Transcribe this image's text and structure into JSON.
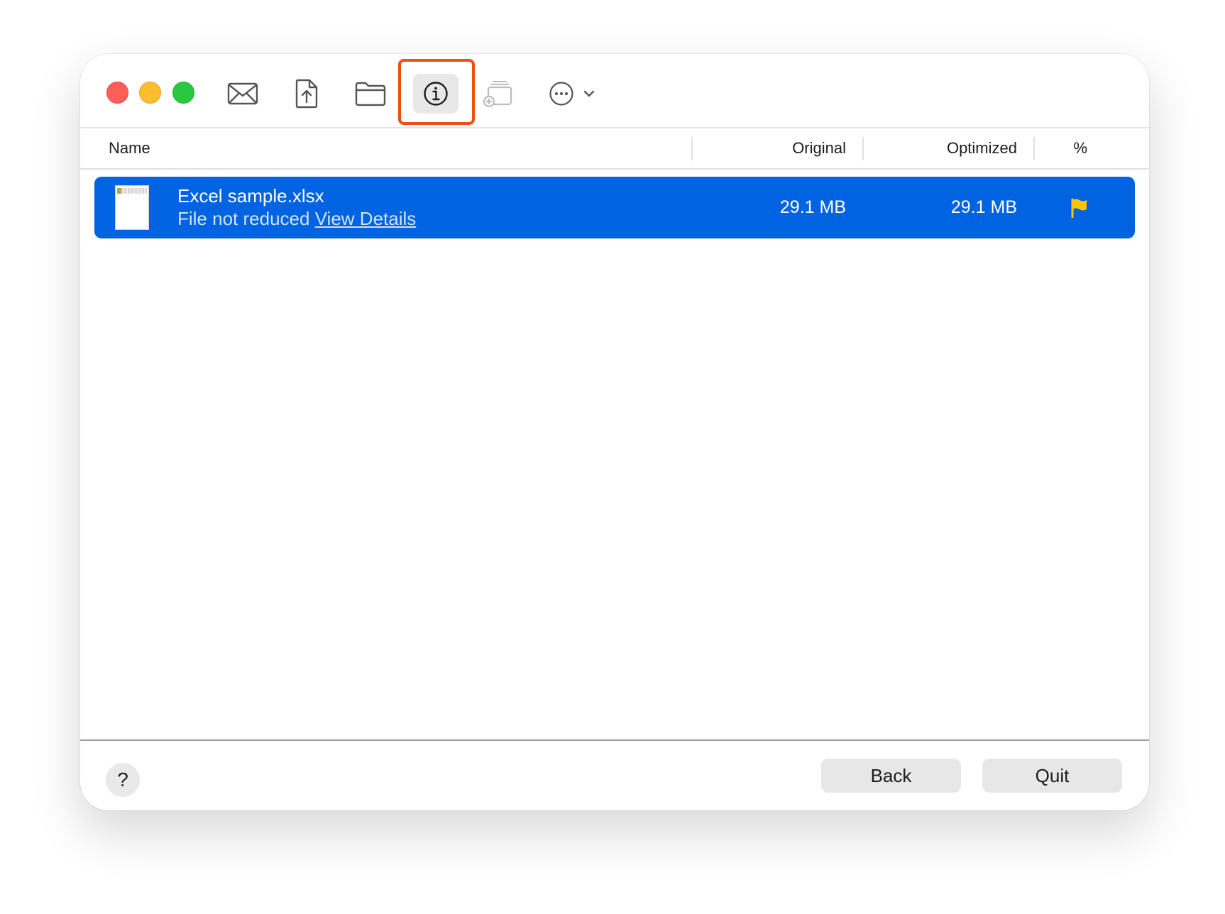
{
  "toolbar": {
    "icons": [
      "envelope-icon",
      "share-file-icon",
      "folder-icon",
      "info-icon",
      "add-to-stack-icon",
      "more-icon",
      "chevron-down-icon"
    ],
    "info_active": true,
    "highlight_color": "#f04e12"
  },
  "table": {
    "columns": {
      "name": "Name",
      "original": "Original",
      "optimized": "Optimized",
      "percent": "%"
    },
    "rows": [
      {
        "file_name": "Excel sample.xlsx",
        "status": "File not reduced",
        "details_link": "View Details",
        "original": "29.1 MB",
        "optimized": "29.1 MB",
        "indicator": "flag-icon"
      }
    ],
    "selection_color": "#0063e1",
    "flag_color": "#ffc400"
  },
  "footer": {
    "help": "?",
    "back": "Back",
    "quit": "Quit"
  }
}
